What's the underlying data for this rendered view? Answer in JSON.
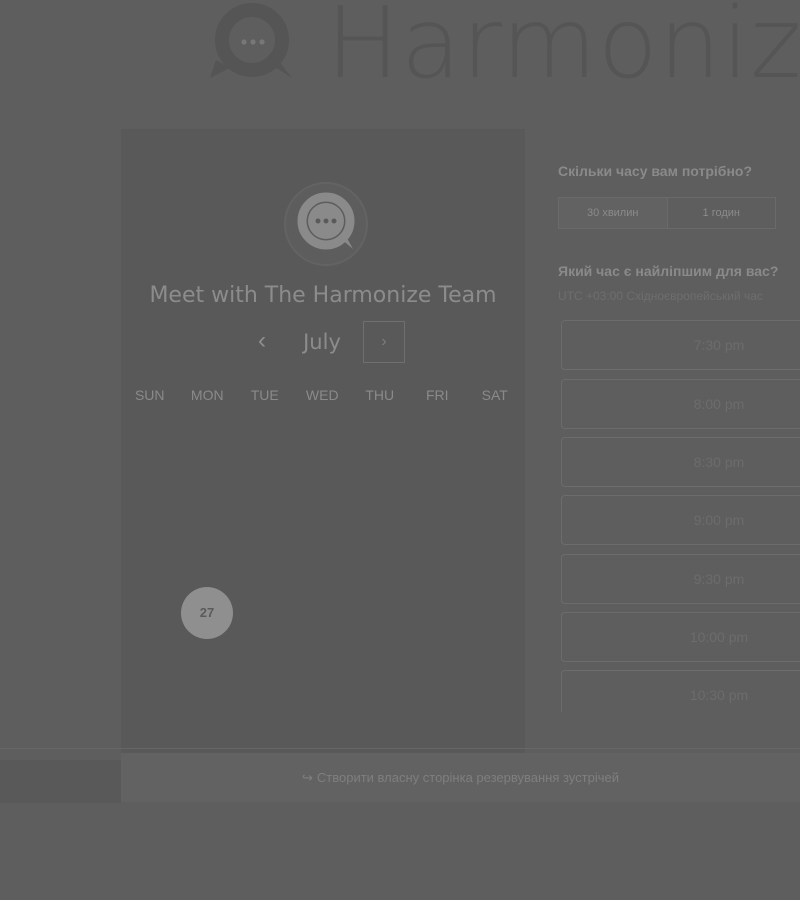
{
  "brand": {
    "name": "Harmonize"
  },
  "calendar": {
    "title": "Meet with The Harmonize Team",
    "month": "July",
    "prev_glyph": "‹",
    "next_glyph": "›",
    "weekdays": [
      "SUN",
      "MON",
      "TUE",
      "WED",
      "THU",
      "FRI",
      "SAT"
    ],
    "highlighted_day": "27"
  },
  "duration": {
    "question": "Скільки часу вам потрібно?",
    "options": [
      "30 хвилин",
      "1 годин"
    ],
    "selected": "30 хвилин"
  },
  "time": {
    "question": "Який час є найліпшим для вас?",
    "timezone": "UTC +03:00 Східноєвропейський час",
    "slots": [
      "7:30 pm",
      "8:00 pm",
      "8:30 pm",
      "9:00 pm",
      "9:30 pm",
      "10:00 pm",
      "10:30 pm"
    ]
  },
  "footer": {
    "link": "Створити власну сторінка резервування зустрічей"
  },
  "colors": {
    "overlay_background": "#5e5e5e",
    "panel": "#595959"
  }
}
